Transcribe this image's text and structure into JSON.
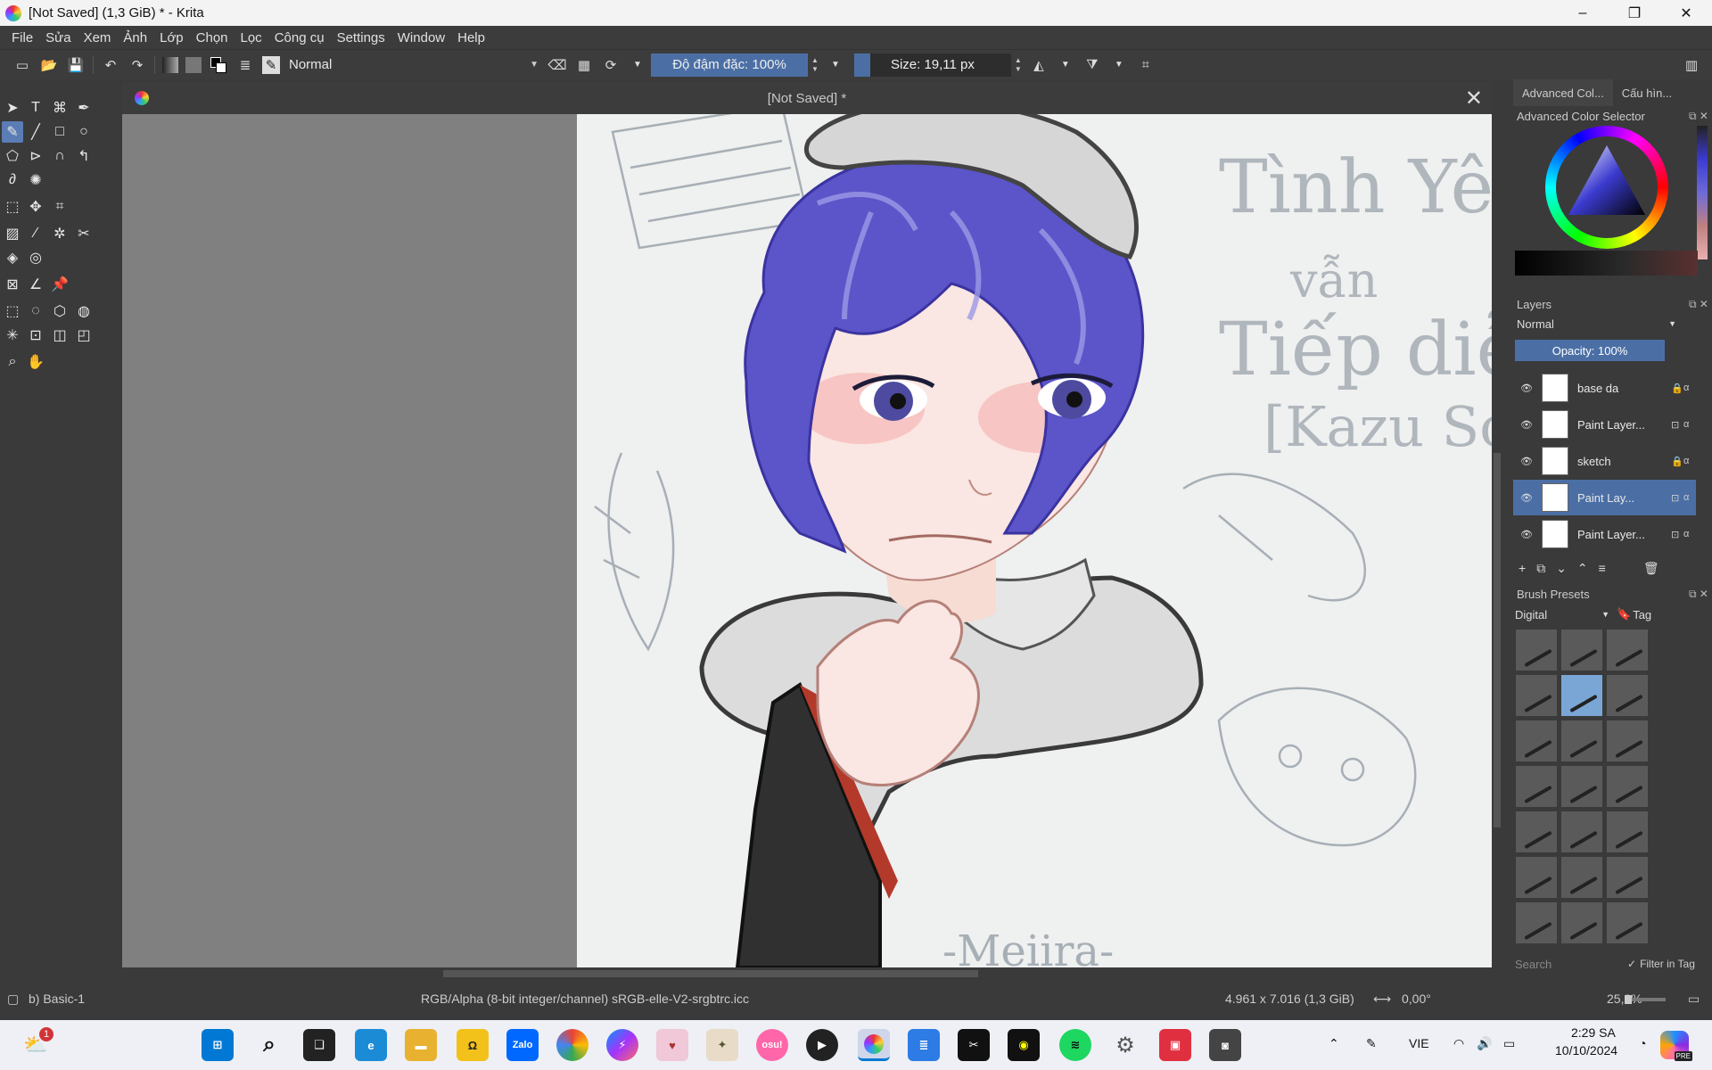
{
  "window": {
    "title": "[Not Saved]  (1,3 GiB)  * - Krita",
    "controls": [
      "–",
      "❐",
      "✕"
    ]
  },
  "menu": [
    "File",
    "Sửa",
    "Xem",
    "Ảnh",
    "Lớp",
    "Chọn",
    "Lọc",
    "Công cụ",
    "Settings",
    "Window",
    "Help"
  ],
  "tool_options": {
    "blend_mode": "Normal",
    "opacity_label": "Độ đậm đặc: 100%",
    "opacity_value": 1.0,
    "size_label": "Size: 19,11 px",
    "size_fill_fraction": 0.1
  },
  "document": {
    "tab_title": "[Not Saved]  *",
    "canvas_text": {
      "line1": "Tình Yêu",
      "line2": "vẫn",
      "line3": "Tiếp diễn",
      "line4": "[Kazu Scaro",
      "signature": "-Meiira-"
    }
  },
  "dock": {
    "tabs": [
      "Advanced Col...",
      "Cấu hìn..."
    ],
    "color_selector_title": "Advanced Color Selector",
    "layers_title": "Layers",
    "layers_blend": "Normal",
    "layers_opacity": "Opacity:  100%",
    "layers": [
      {
        "name": "base da",
        "selected": false,
        "locked": true
      },
      {
        "name": "Paint Layer...",
        "selected": false,
        "locked": false
      },
      {
        "name": "sketch",
        "selected": false,
        "locked": true
      },
      {
        "name": "Paint Lay...",
        "selected": true,
        "locked": false
      },
      {
        "name": "Paint Layer...",
        "selected": false,
        "locked": false
      }
    ],
    "brush_presets_title": "Brush Presets",
    "brush_tag": "Digital",
    "tag_label": "Tag",
    "search_placeholder": "Search",
    "filter_in_tag": "Filter in Tag"
  },
  "status": {
    "brush": "b) Basic-1",
    "color_space": "RGB/Alpha (8-bit integer/channel)  sRGB-elle-V2-srgbtrc.icc",
    "dimensions": "4.961 x 7.016 (1,3 GiB)",
    "rotation": "0,00°",
    "zoom": "25,0%"
  },
  "taskbar": {
    "weather_badge": "1",
    "zalo_label": "Zalo",
    "osu_label": "osu!",
    "language": "VIE",
    "time": "2:29 SA",
    "date": "10/10/2024",
    "copilot_badge": "PRE"
  },
  "colors": {
    "accent": "#4b6fa5",
    "hair": "#5b55c9",
    "panel": "#3a3a3a",
    "canvas_gray": "#808080"
  }
}
